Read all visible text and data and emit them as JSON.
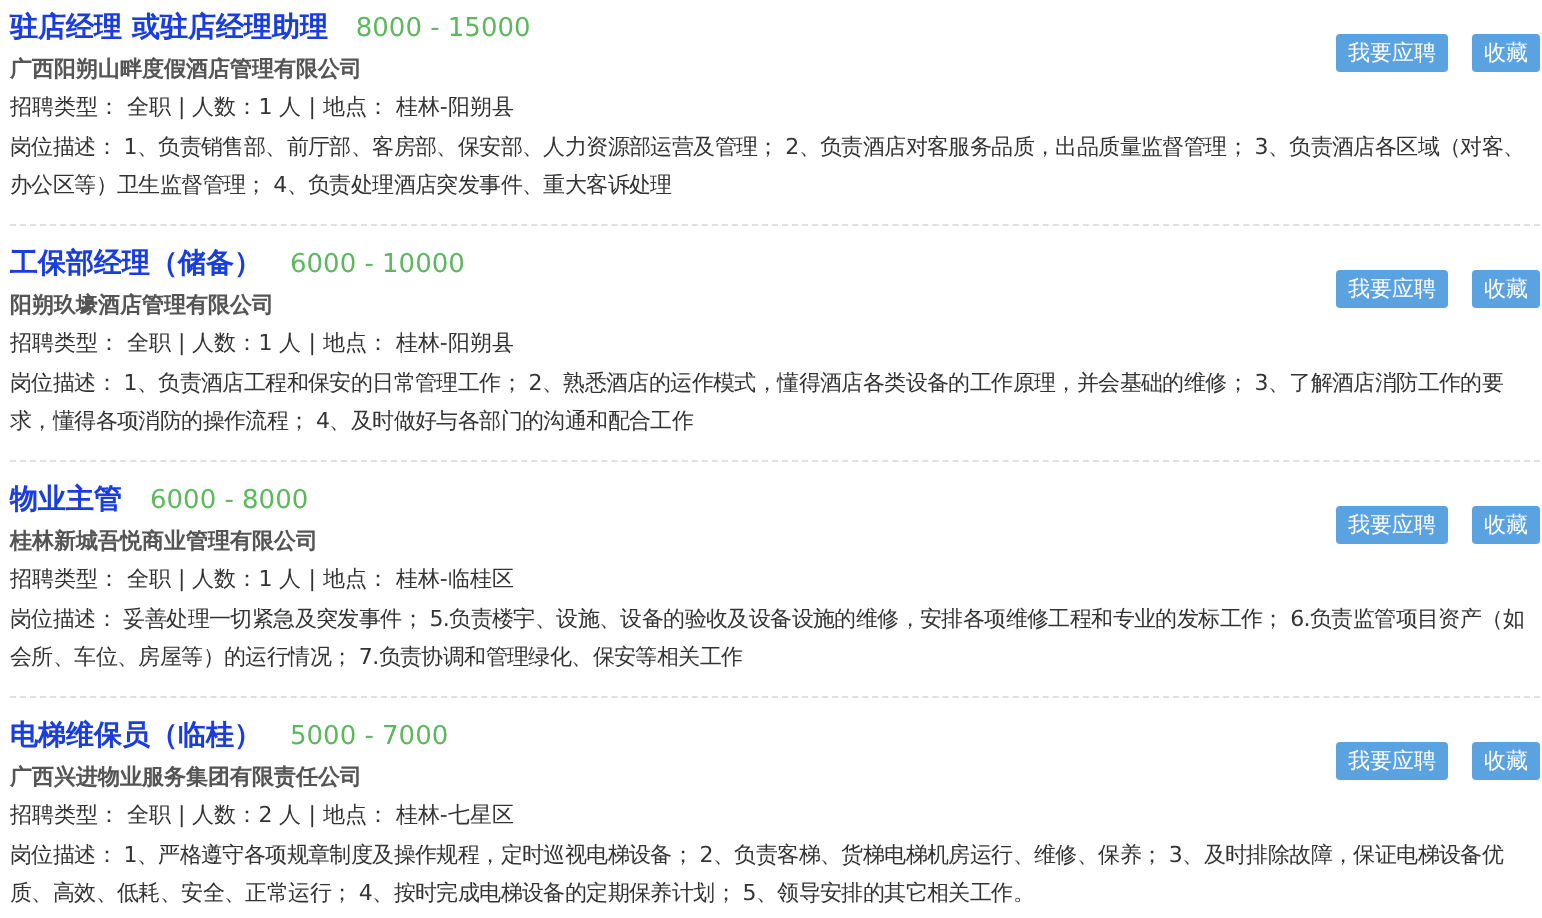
{
  "jobs": [
    {
      "title": "驻店经理 或驻店经理助理",
      "salary": "8000 - 15000",
      "company": "广西阳朔山畔度假酒店管理有限公司",
      "info": "招聘类型： 全职 | 人数：1 人 | 地点： 桂林-阳朔县",
      "description": "岗位描述： 1、负责销售部、前厅部、客房部、保安部、人力资源部运营及管理； 2、负责酒店对客服务品质，出品质量监督管理； 3、负责酒店各区域（对客、办公区等）卫生监督管理； 4、负责处理酒店突发事件、重大客诉处理",
      "buttons": [
        "我要应聘",
        "收藏"
      ]
    },
    {
      "title": "工保部经理（储备）",
      "salary": "6000 - 10000",
      "company": "阳朔玖壕酒店管理有限公司",
      "info": "招聘类型： 全职 | 人数：1 人 | 地点： 桂林-阳朔县",
      "description": "岗位描述： 1、负责酒店工程和保安的日常管理工作； 2、熟悉酒店的运作模式，懂得酒店各类设备的工作原理，并会基础的维修； 3、了解酒店消防工作的要求，懂得各项消防的操作流程； 4、及时做好与各部门的沟通和配合工作",
      "buttons": [
        "我要应聘",
        "收藏"
      ]
    },
    {
      "title": "物业主管",
      "salary": "6000 - 8000",
      "company": "桂林新城吾悦商业管理有限公司",
      "info": "招聘类型： 全职 | 人数：1 人 | 地点： 桂林-临桂区",
      "description": "岗位描述： 妥善处理一切紧急及突发事件； 5.负责楼宇、设施、设备的验收及设备设施的维修，安排各项维修工程和专业的发标工作； 6.负责监管项目资产（如会所、车位、房屋等）的运行情况； 7.负责协调和管理绿化、保安等相关工作",
      "buttons": [
        "我要应聘",
        "收藏"
      ]
    },
    {
      "title": "电梯维保员（临桂）",
      "salary": "5000 - 7000",
      "company": "广西兴进物业服务集团有限责任公司",
      "info": "招聘类型： 全职 | 人数：2 人 | 地点： 桂林-七星区",
      "description": "岗位描述： 1、严格遵守各项规章制度及操作规程，定时巡视电梯设备； 2、负责客梯、货梯电梯机房运行、维修、保养； 3、及时排除故障，保证电梯设备优质、高效、低耗、安全、正常运行； 4、按时完成电梯设备的定期保养计划； 5、领导安排的其它相关工作。",
      "buttons": [
        "我要应聘",
        "收藏"
      ]
    }
  ]
}
